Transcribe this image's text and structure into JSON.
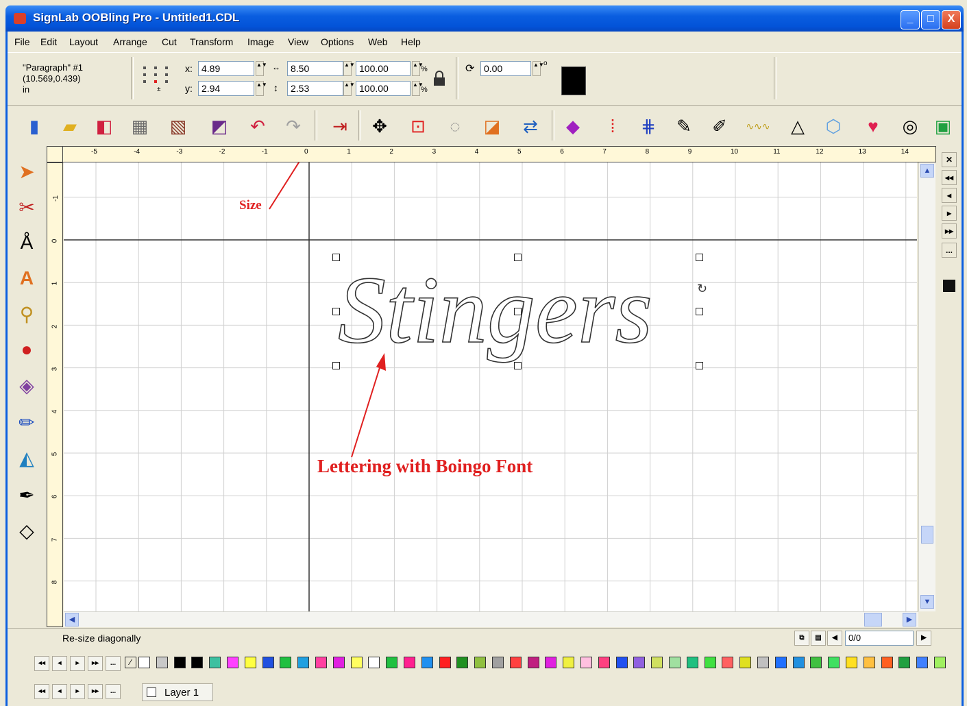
{
  "window": {
    "title": "SignLab OOBling Pro - Untitled1.CDL",
    "min": "_",
    "max": "□",
    "close": "X"
  },
  "menu": [
    "File",
    "Edit",
    "Layout",
    "Arrange",
    "Cut",
    "Transform",
    "Image",
    "View",
    "Options",
    "Web",
    "Help"
  ],
  "props": {
    "object_name": "\"Paragraph\" #1",
    "object_pos": "(10.569,0.439)",
    "units": "in",
    "x_label": "x:",
    "x": "4.89",
    "y_label": "y:",
    "y": "2.94",
    "width": "8.50",
    "height": "2.53",
    "scale_w": "100.00",
    "scale_h": "100.00",
    "pct": "%",
    "rotation": "0.00",
    "deg": "o"
  },
  "ruler": {
    "h": [
      "-5",
      "-4",
      "-3",
      "-2",
      "-1",
      "0",
      "1",
      "2",
      "3",
      "4",
      "5",
      "6",
      "7",
      "8",
      "9",
      "10",
      "11",
      "12",
      "13",
      "14"
    ],
    "v": [
      "-1",
      "0",
      "1",
      "2",
      "3",
      "4",
      "5",
      "6",
      "7",
      "8"
    ]
  },
  "canvas": {
    "artwork_text": "Stingers",
    "annotation_size": "Size",
    "annotation_lettering": "Lettering with Boingo Font"
  },
  "status": {
    "hint": "Re-size diagonally",
    "page": "0/0"
  },
  "layers": {
    "name": "Layer 1",
    "more": "..."
  },
  "palette": [
    "#ffffff",
    "#c8c8c8",
    "#000000",
    "#000000",
    "#3cc0a0",
    "#ff40ff",
    "#ffff40",
    "#2050e0",
    "#20c040",
    "#20a0e0",
    "#ff40a0",
    "#e020e0",
    "#ffff60",
    "#ffffff",
    "#20c040",
    "#ff2090",
    "#2090f0",
    "#ff2020",
    "#209020",
    "#90c040",
    "#a0a0a0",
    "#ff4040",
    "#c02080",
    "#e020e0",
    "#f0f040",
    "#ffc0e0",
    "#ff4080",
    "#2050f0",
    "#9060e0",
    "#d0e060",
    "#a0e0a0",
    "#20c080",
    "#40e040",
    "#ff6060",
    "#e0e020",
    "#c0c0c0",
    "#2070ff",
    "#2090e0",
    "#40c040",
    "#40e060",
    "#ffe020",
    "#ffc040",
    "#ff6020",
    "#20a040",
    "#4080ff",
    "#a0f060"
  ]
}
